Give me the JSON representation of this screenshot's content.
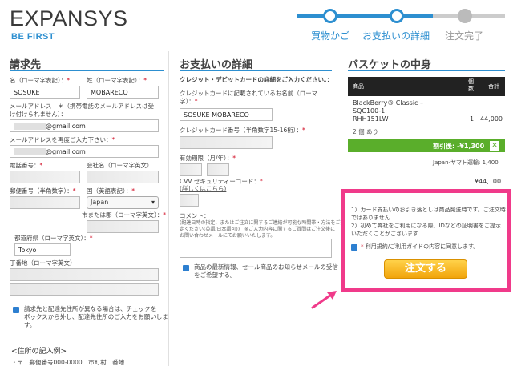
{
  "header": {
    "logo": "EXPANSYS",
    "tagline": "BE FIRST",
    "steps": [
      "買物かご",
      "お支払いの詳細",
      "注文完了"
    ]
  },
  "billing": {
    "title": "請求先",
    "lastname_label": "名（ローマ字表記）：",
    "lastname_value": "SOSUKE",
    "firstname_label": "姓（ローマ字表記）：",
    "firstname_value": "MOBARECO",
    "email_label_1": "メールアドレス　＊（携帯電話のメールアドレスは受",
    "email_label_2": "け付けられません）：",
    "email_value": "@gmail.com",
    "email_confirm_label": "メールアドレスを再度ご入力下さい：",
    "email_confirm_value": "@gmail.com",
    "phone_label": "電話番号：",
    "company_label": "会社名（ローマ字英文）",
    "zip_label": "郵便番号（半角数字）：",
    "country_label": "国（英語表記）：",
    "country_value": "Japan",
    "city_label": "市または郡（ローマ字英文）：",
    "pref_label": "都道府県（ローマ字英文）：",
    "pref_value": "Tokyo",
    "street_label": "丁番地（ローマ字英文）",
    "shipping_note_1": "請求先と配達先住所が異なる場合は、チェックを",
    "shipping_note_2": "ボックスから外し、配達先住所のご入力をお願いしま",
    "shipping_note_3": "す。",
    "example_heading": "<住所の記入例>",
    "example_text": "・〒　郵便番号000-0000　市町村　番地"
  },
  "payment": {
    "title": "お支払いの詳細",
    "intro": "クレジット・デビットカードの詳細をご入力ください。：",
    "cardname_label_1": "クレジットカードに記載されているお名前（ローマ",
    "cardname_label_2": "字）：",
    "cardname_value": "SOSUKE MOBARECO",
    "cardnum_label": "クレジットカード番号（半角数字15-16桁）：",
    "expiry_label": "有効期限（月/年）：",
    "cvv_label": "CVV セキュリティーコード：",
    "cvv_help": "(詳しくはこちら)",
    "comment_label": "コメント：",
    "comment_hint_1": "(配達日時の指定、またはご注文に関するご連絡が可能な時間帯・方法をご指",
    "comment_hint_2": "定ください(英語/日本語可))　※ご入力内容に関するご質問はご注文後に",
    "comment_hint_3": "お問い合わせメールにてお願いいたします。",
    "newsletter_1": "商品の最新情報、セール商品のお知らせメールの受信",
    "newsletter_2": "をご希望する。"
  },
  "basket": {
    "title": "バスケットの中身",
    "col_product": "商品",
    "col_qty": "個数",
    "col_total": "合計",
    "item_name_1": "BlackBerry® Classic –",
    "item_name_2": "SQC100-1:",
    "item_name_3": "RHH151LW",
    "item_qty": "1",
    "item_price": "44,000",
    "stock": "2 個 あり",
    "discount": "割引後: -¥1,300",
    "discount_close": "✕",
    "shipping": "Japan-ヤマト運輸: 1,400",
    "total": "¥44,100"
  },
  "order_box": {
    "note_1": "1）カード支払いのお引き落としは商品発送時です。ご注文時",
    "note_2": "ではありません",
    "note_3": "2）初めて弊社をご利用になる際、IDなどの証明書をご提示",
    "note_4": "いただくことがございます",
    "terms": "利用規約/ご利用ガイドの内容に同意します。",
    "button": "注文する"
  },
  "colors": {
    "accent": "#2d8fd0",
    "highlight": "#f03a8a",
    "discount": "#5aae2b",
    "button": "#f1a40b"
  }
}
